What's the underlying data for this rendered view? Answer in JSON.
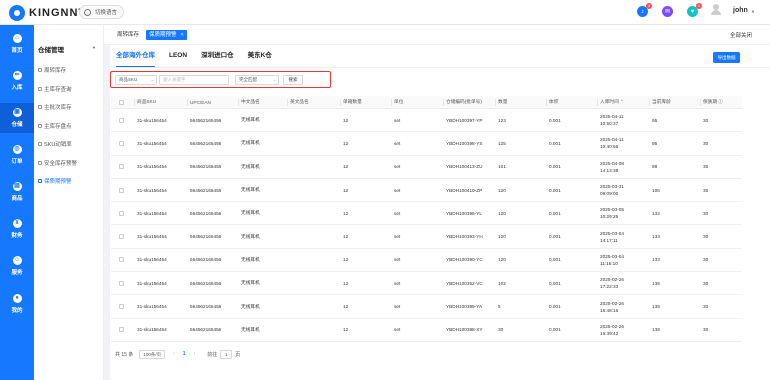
{
  "app": {
    "logo_text": "KINGNNT",
    "lang_label": "切换语言",
    "user_name": "john",
    "notifications": [
      {
        "name": "bell-icon",
        "badge": "4",
        "color": "#1677ff"
      },
      {
        "name": "message-icon",
        "badge": "",
        "color": "#7c4dff"
      },
      {
        "name": "service-icon",
        "badge": "4",
        "color": "#13c2c2"
      }
    ]
  },
  "iconbar": [
    {
      "icon": "home-icon",
      "glyph": "⌂",
      "label": "首页"
    },
    {
      "icon": "inbound-icon",
      "glyph": "⇐",
      "label": "入库"
    },
    {
      "icon": "warehouse-icon",
      "glyph": "▣",
      "label": "仓储"
    },
    {
      "icon": "order-icon",
      "glyph": "◎",
      "label": "订单"
    },
    {
      "icon": "product-icon",
      "glyph": "▤",
      "label": "商品"
    },
    {
      "icon": "finance-icon",
      "glyph": "¥",
      "label": "财务"
    },
    {
      "icon": "service-icon",
      "glyph": "☺",
      "label": "服务"
    },
    {
      "icon": "profile-icon",
      "glyph": "●",
      "label": "我的"
    }
  ],
  "submenu": {
    "title": "仓储管理",
    "items": [
      "周转库存",
      "主库存查询",
      "主批次库存",
      "主库存盘点",
      "SKU动销率",
      "安全库存预警",
      "保质期预警"
    ]
  },
  "page_tabs": [
    "周转库存",
    "保质期预警"
  ],
  "close_all": "全部关闭",
  "warehouse_tabs": [
    "全部海外仓库",
    "LEON",
    "深圳进口仓",
    "美东K仓"
  ],
  "filter": {
    "sku_select": "商品SKU",
    "input_placeholder": "输入关键字",
    "match_select": "完全匹配",
    "search_button": "搜索"
  },
  "export_button": "导出数据",
  "table": {
    "columns": [
      "商品SKU",
      "UPC/EAN",
      "中文品名",
      "英文品名",
      "单箱数量",
      "单位",
      "仓储编码(批单号)",
      "数量",
      "体积",
      "入库时间 ⌃",
      "当前库龄",
      "保质期 ⓘ"
    ],
    "rows": [
      [
        "31-sku156454",
        "564562165456",
        "无线耳机",
        "",
        "12",
        "set",
        "YBDH100397-YP",
        "123",
        "0.001",
        "2025-04-11 10:50:37",
        "95",
        "30"
      ],
      [
        "31-sku156454",
        "564562165456",
        "无线耳机",
        "",
        "12",
        "set",
        "YBDH100398-YS",
        "125",
        "0.001",
        "2025-04-11 10:40:56",
        "95",
        "30"
      ],
      [
        "31-sku156454",
        "564562165456",
        "无线耳机",
        "",
        "12",
        "set",
        "YBDH100413-ZU",
        "101",
        "0.001",
        "2025-04-08 14:13:38",
        "98",
        "30"
      ],
      [
        "31-sku156454",
        "564562165456",
        "无线耳机",
        "",
        "12",
        "set",
        "YBDH100410-ZP",
        "120",
        "0.001",
        "2025-03-31 09:09:00",
        "106",
        "30"
      ],
      [
        "31-sku156454",
        "564562165456",
        "无线耳机",
        "",
        "12",
        "set",
        "YBDH100395-YL",
        "120",
        "0.001",
        "2025-03-05 10:29:26",
        "132",
        "30"
      ],
      [
        "31-sku156454",
        "564562165456",
        "无线耳机",
        "",
        "12",
        "set",
        "YBDH100393-YH",
        "120",
        "0.001",
        "2025-03-04 14:17:11",
        "133",
        "30"
      ],
      [
        "31-sku156454",
        "564562165456",
        "无线耳机",
        "",
        "12",
        "set",
        "YBDH100390-YC",
        "120",
        "0.001",
        "2025-03-04 11:16:10",
        "133",
        "30"
      ],
      [
        "31-sku156454",
        "564562165456",
        "无线耳机",
        "",
        "12",
        "set",
        "YBDH100352-VC",
        "102",
        "0.001",
        "2025-02-26 17:22:33",
        "139",
        "30"
      ],
      [
        "31-sku156454",
        "564562165456",
        "无线耳机",
        "",
        "12",
        "set",
        "YBDH100389-YA",
        "5",
        "0.001",
        "2025-02-26 16:48:16",
        "139",
        "30"
      ],
      [
        "31-sku156454",
        "564562165456",
        "无线耳机",
        "",
        "12",
        "set",
        "YBDH100388-XY",
        "30",
        "0.001",
        "2025-02-26 16:39:42",
        "139",
        "30"
      ]
    ]
  },
  "pagination": {
    "total": "共 15 条",
    "page_size": "100条/页",
    "prev": "‹",
    "current": "1",
    "next": "›",
    "jump_label": "前往",
    "jump_value": "1",
    "jump_unit": "页"
  }
}
